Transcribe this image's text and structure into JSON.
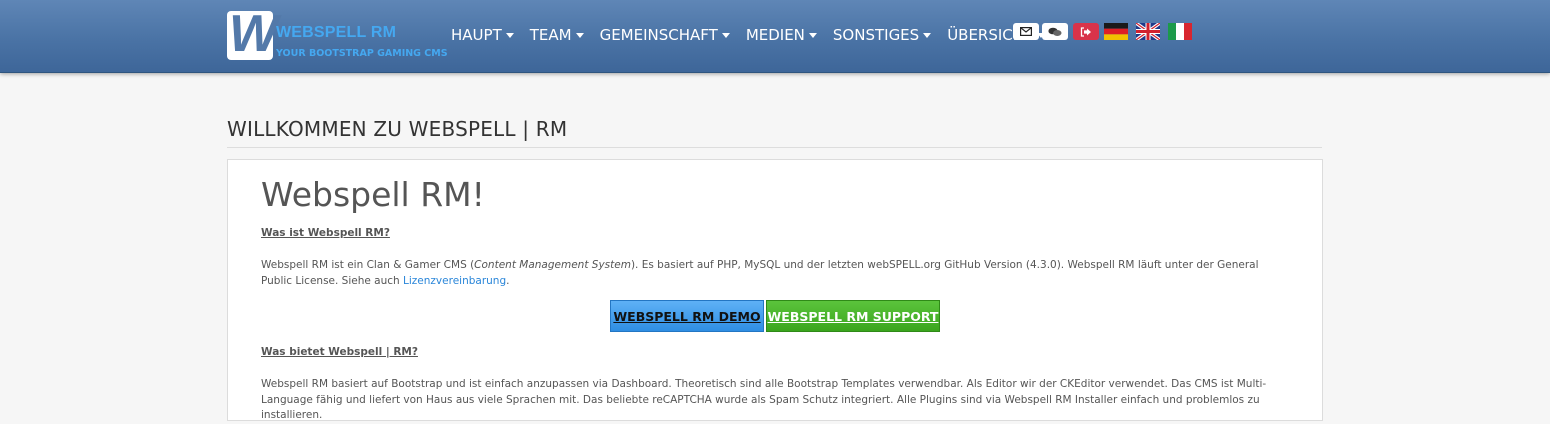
{
  "brand": {
    "logo_letter": "W",
    "title": "WEBSPELL RM",
    "subtitle": "YOUR BOOTSTRAP GAMING CMS"
  },
  "nav": {
    "items": [
      {
        "label": "HAUPT"
      },
      {
        "label": "TEAM"
      },
      {
        "label": "GEMEINSCHAFT"
      },
      {
        "label": "MEDIEN"
      },
      {
        "label": "SONSTIGES"
      },
      {
        "label": "ÜBERSICHT"
      }
    ],
    "icons": [
      "envelope-icon",
      "chat-icon",
      "login-icon"
    ],
    "flags": [
      "flag-germany",
      "flag-united-kingdom",
      "flag-italy"
    ]
  },
  "page": {
    "heading": "WILLKOMMEN ZU WEBSPELL | RM"
  },
  "panel": {
    "title": "Webspell RM!",
    "q1": "Was ist Webspell RM?",
    "p1_a": "Webspell RM ist ein Clan & Gamer CMS (",
    "p1_em": "Content Management System",
    "p1_b": "). Es basiert auf PHP, MySQL und der letzten webSPELL.org GitHub Version (4.3.0). Webspell RM läuft unter der General Public License. Siehe auch ",
    "p1_link": "Lizenzvereinbarung",
    "p1_c": ".",
    "demo_button": "WEBSPELL RM DEMO",
    "support_button": "WEBSPELL RM SUPPORT",
    "q2": "Was bietet Webspell | RM?",
    "p2": "Webspell RM basiert auf Bootstrap und ist einfach anzupassen via Dashboard. Theoretisch sind alle Bootstrap Templates verwendbar. Als Editor wir der CKEditor verwendet. Das CMS ist Multi-Language fähig und liefert von Haus aus viele Sprachen mit. Das beliebte reCAPTCHA wurde als Spam Schutz integriert. Alle Plugins sind via Webspell RM Installer einfach und problemlos zu installieren."
  },
  "colors": {
    "navbar": "#4a73a5",
    "brand_accent": "#45a8f0",
    "demo_button": "#3d9be9",
    "support_button": "#46b128",
    "login_button": "#d9334a",
    "link": "#2a86d9"
  }
}
